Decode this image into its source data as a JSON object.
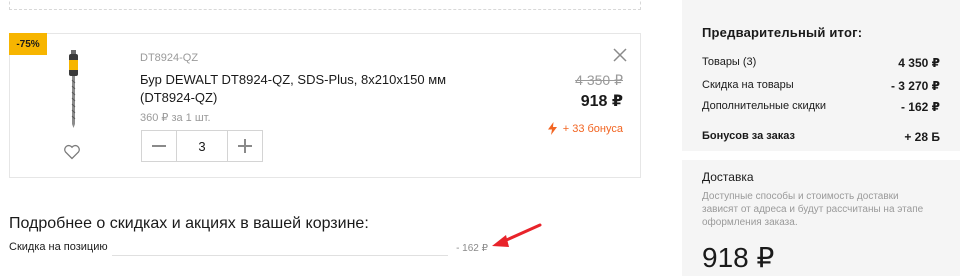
{
  "cart_item": {
    "badge": "-75%",
    "sku": "DT8924-QZ",
    "title": "Бур DEWALT DT8924-QZ, SDS-Plus, 8x210x150 мм (DT8924-QZ)",
    "unit_price": "360 ₽ за 1 шт.",
    "quantity": "3",
    "old_price": "4 350 ₽",
    "new_price": "918 ₽",
    "bonus": "+ 33 бонуса",
    "colors": {
      "badge": "#f7b500",
      "bonus": "#f26522"
    }
  },
  "discounts": {
    "title": "Подробнее о скидках и акциях в вашей корзине:",
    "rows": [
      {
        "label": "Скидка на позицию",
        "value": "- 162 ₽"
      }
    ],
    "arrow_color": "#e8232a"
  },
  "summary": {
    "title": "Предварительный итог:",
    "lines": [
      {
        "label": "Товары (3)",
        "value": "4 350 ₽"
      },
      {
        "label": "Скидка на товары",
        "value": "- 3 270 ₽"
      },
      {
        "label": "Дополнительные скидки",
        "value": "- 162 ₽"
      },
      {
        "label": "Бонусов за заказ",
        "value": "+ 28 Б"
      }
    ],
    "delivery_title": "Доставка",
    "delivery_note": "Доступные способы и стоимость доставки зависят от адреса и будут рассчитаны на этапе оформления заказа.",
    "total": "918 ₽"
  },
  "icons": [
    "drill-bit-image",
    "heart-icon",
    "close-icon",
    "minus-icon",
    "plus-icon",
    "lightning-icon",
    "arrow-annotation"
  ]
}
